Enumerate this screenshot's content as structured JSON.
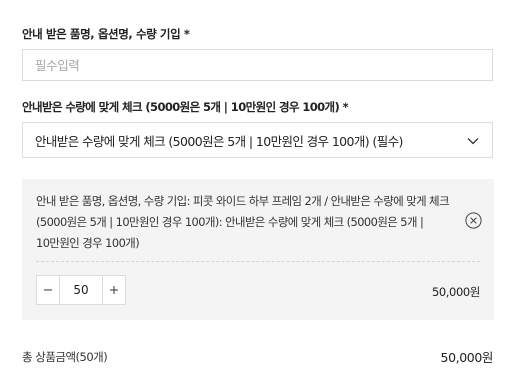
{
  "option_name_field": {
    "label": "안내 받은 품명, 옵션명, 수량 기입 *",
    "placeholder": "필수입력",
    "value": ""
  },
  "quantity_select": {
    "label": "안내받은 수량에 맞게 체크 (5000원은 5개 | 10만원인 경우 100개) *",
    "selected_value": "안내받은 수량에 맞게 체크 (5000원은 5개 | 10만원인 경우 100개) (필수)"
  },
  "selected_option": {
    "description": "안내 받은 품명, 옵션명, 수량 기입: 피콧 와이드 하부 프레임 2개 / 안내받은 수량에 맞게 체크 (5000원은 5개 | 10만원인 경우 100개): 안내받은 수량에 맞게 체크 (5000원은 5개 | 10만원인 경우 100개)",
    "quantity": "50",
    "price": "50,000원"
  },
  "summary": {
    "total_label": "총 상품금액(50개)",
    "total_value": "50,000원"
  },
  "icons": {
    "dropdown": "chevron-down-icon",
    "remove": "close-circle-icon",
    "decrease": "minus-icon",
    "increase": "plus-icon"
  }
}
